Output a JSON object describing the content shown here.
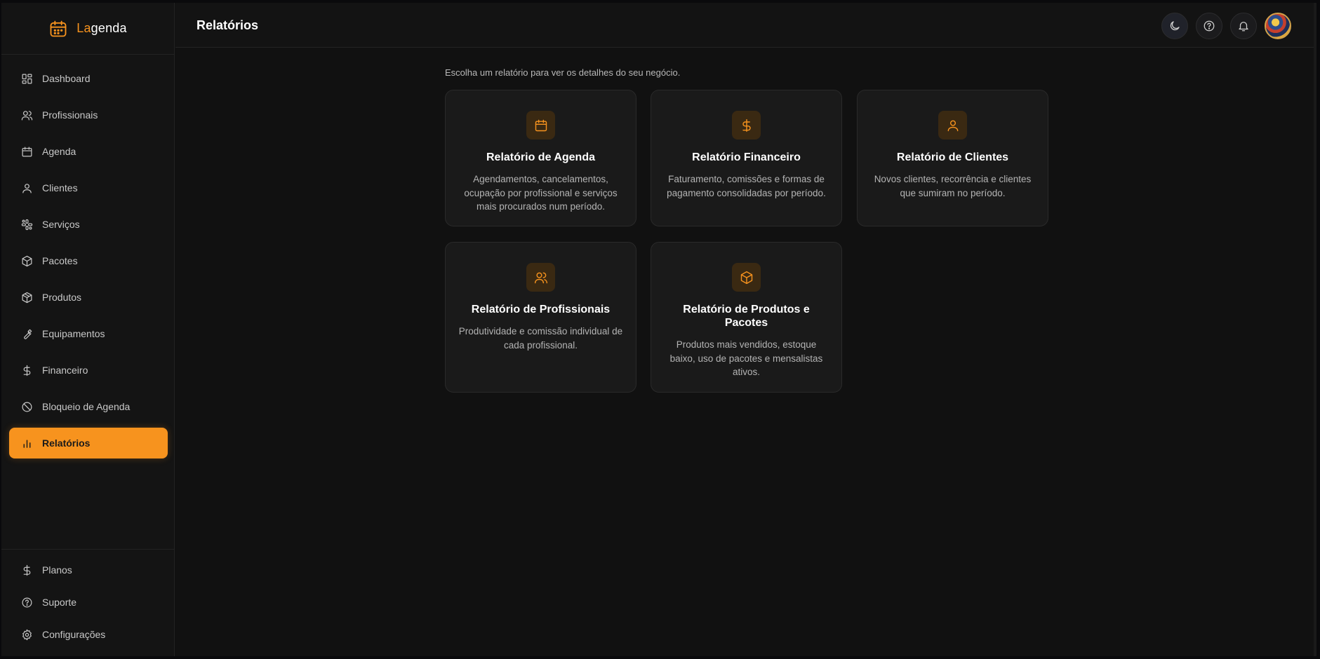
{
  "brand": {
    "prefix": "La",
    "suffix": "genda"
  },
  "sidebar": {
    "items": [
      {
        "label": "Dashboard",
        "icon": "dashboard-icon"
      },
      {
        "label": "Profissionais",
        "icon": "users-icon"
      },
      {
        "label": "Agenda",
        "icon": "calendar-icon"
      },
      {
        "label": "Clientes",
        "icon": "user-icon"
      },
      {
        "label": "Serviços",
        "icon": "services-icon"
      },
      {
        "label": "Pacotes",
        "icon": "package-icon"
      },
      {
        "label": "Produtos",
        "icon": "box-icon"
      },
      {
        "label": "Equipamentos",
        "icon": "wrench-icon"
      },
      {
        "label": "Financeiro",
        "icon": "dollar-icon"
      },
      {
        "label": "Bloqueio de Agenda",
        "icon": "block-icon"
      },
      {
        "label": "Relatórios",
        "icon": "bar-chart-icon",
        "active": true
      }
    ],
    "bottom": [
      {
        "label": "Planos",
        "icon": "dollar-icon"
      },
      {
        "label": "Suporte",
        "icon": "help-icon"
      },
      {
        "label": "Configurações",
        "icon": "gear-icon"
      }
    ]
  },
  "header": {
    "title": "Relatórios"
  },
  "main": {
    "subtitle": "Escolha um relatório para ver os detalhes do seu negócio.",
    "cards": [
      {
        "title": "Relatório de Agenda",
        "description": "Agendamentos, cancelamentos, ocupação por profissional e serviços mais procurados num período.",
        "icon": "calendar-icon"
      },
      {
        "title": "Relatório Financeiro",
        "description": "Faturamento, comissões e formas de pagamento consolidadas por período.",
        "icon": "dollar-icon"
      },
      {
        "title": "Relatório de Clientes",
        "description": "Novos clientes, recorrência e clientes que sumiram no período.",
        "icon": "user-icon"
      },
      {
        "title": "Relatório de Profissionais",
        "description": "Produtividade e comissão individual de cada profissional.",
        "icon": "users-icon"
      },
      {
        "title": "Relatório de Produtos e Pacotes",
        "description": "Produtos mais vendidos, estoque baixo, uso de pacotes e mensalistas ativos.",
        "icon": "package-icon"
      }
    ]
  },
  "colors": {
    "accent": "#f7931e",
    "background": "#111111",
    "card": "#1a1a1a",
    "sidebar": "#141414"
  }
}
